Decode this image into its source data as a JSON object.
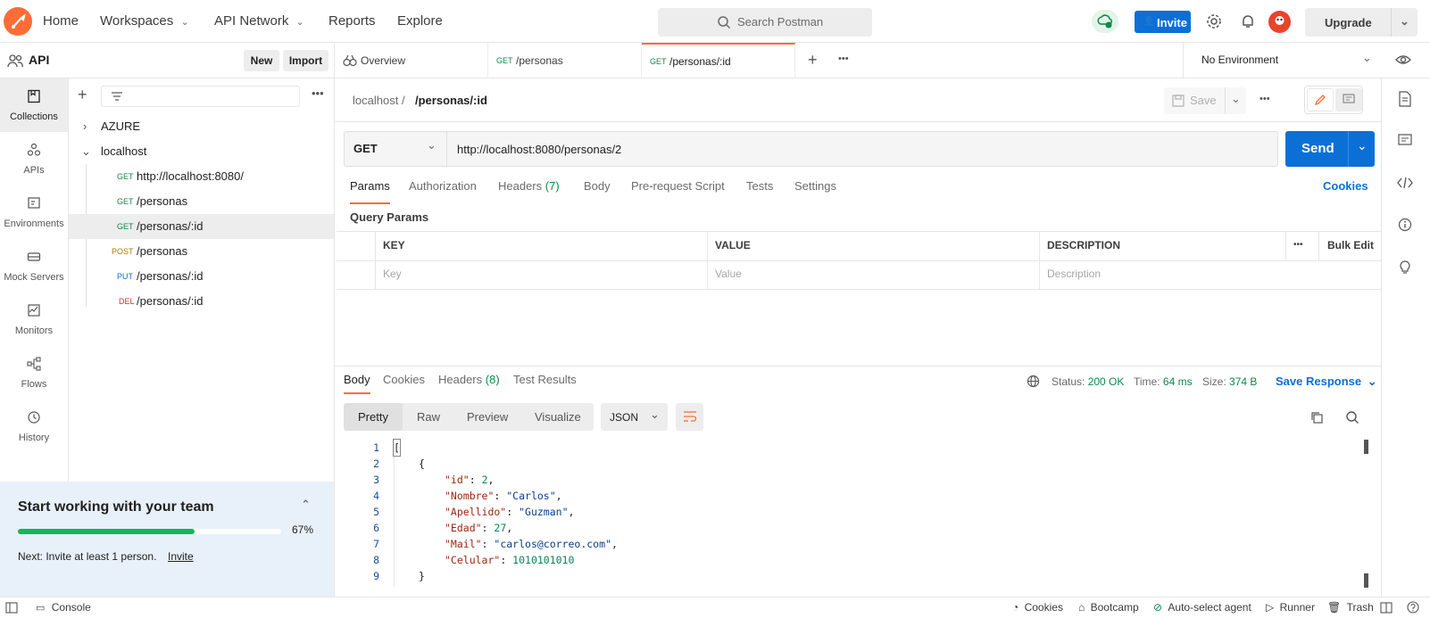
{
  "topbar": {
    "nav": [
      "Home",
      "Workspaces",
      "API Network",
      "Reports",
      "Explore"
    ],
    "search_placeholder": "Search Postman",
    "invite_label": "Invite",
    "upgrade_label": "Upgrade"
  },
  "workspace": {
    "name": "API",
    "new_label": "New",
    "import_label": "Import"
  },
  "rail": [
    "Collections",
    "APIs",
    "Environments",
    "Mock Servers",
    "Monitors",
    "Flows",
    "History"
  ],
  "tree": {
    "collections": [
      "AZURE",
      "localhost"
    ],
    "requests": [
      {
        "method": "GET",
        "name": "http://localhost:8080/"
      },
      {
        "method": "GET",
        "name": "/personas"
      },
      {
        "method": "GET",
        "name": "/personas/:id"
      },
      {
        "method": "POST",
        "name": "/personas"
      },
      {
        "method": "PUT",
        "name": "/personas/:id"
      },
      {
        "method": "DEL",
        "name": "/personas/:id"
      }
    ]
  },
  "team_card": {
    "title": "Start working with your team",
    "progress_percent": 67,
    "progress_label": "67%",
    "next_text": "Next: Invite at least 1 person.",
    "invite_link": "Invite"
  },
  "tabs": [
    {
      "label": "Overview"
    },
    {
      "method": "GET",
      "label": "/personas"
    },
    {
      "method": "GET",
      "label": "/personas/:id"
    }
  ],
  "environment": "No Environment",
  "breadcrumb": {
    "collection": "localhost",
    "sep": "/",
    "request": "/personas/:id"
  },
  "save_label": "Save",
  "request": {
    "method": "GET",
    "url": "http://localhost:8080/personas/2",
    "send_label": "Send",
    "tabs": [
      "Params",
      "Authorization",
      "Headers",
      "Body",
      "Pre-request Script",
      "Tests",
      "Settings"
    ],
    "headers_count": "(7)",
    "cookies_label": "Cookies",
    "query_params_label": "Query Params",
    "columns": [
      "KEY",
      "VALUE",
      "DESCRIPTION"
    ],
    "bulk_edit": "Bulk Edit",
    "placeholders": [
      "Key",
      "Value",
      "Description"
    ]
  },
  "response": {
    "tabs": [
      "Body",
      "Cookies",
      "Headers",
      "Test Results"
    ],
    "headers_count": "(8)",
    "status_label": "Status:",
    "status_value": "200 OK",
    "time_label": "Time:",
    "time_value": "64 ms",
    "size_label": "Size:",
    "size_value": "374 B",
    "save_response": "Save Response",
    "view_modes": [
      "Pretty",
      "Raw",
      "Preview",
      "Visualize"
    ],
    "format": "JSON",
    "line_numbers": [
      "1",
      "2",
      "3",
      "4",
      "5",
      "6",
      "7",
      "8",
      "9"
    ],
    "json": {
      "id": "2",
      "Nombre": "\"Carlos\"",
      "Apellido": "\"Guzman\"",
      "Edad": "27",
      "Mail": "\"carlos@correo.com\"",
      "Celular": "1010101010"
    }
  },
  "statusbar": {
    "console": "Console",
    "cookies": "Cookies",
    "bootcamp": "Bootcamp",
    "auto_select": "Auto-select agent",
    "runner": "Runner",
    "trash": "Trash"
  },
  "colors": {
    "accent": "#ff6c37",
    "primary": "#0c6fd5",
    "success": "#0a8a4a"
  }
}
